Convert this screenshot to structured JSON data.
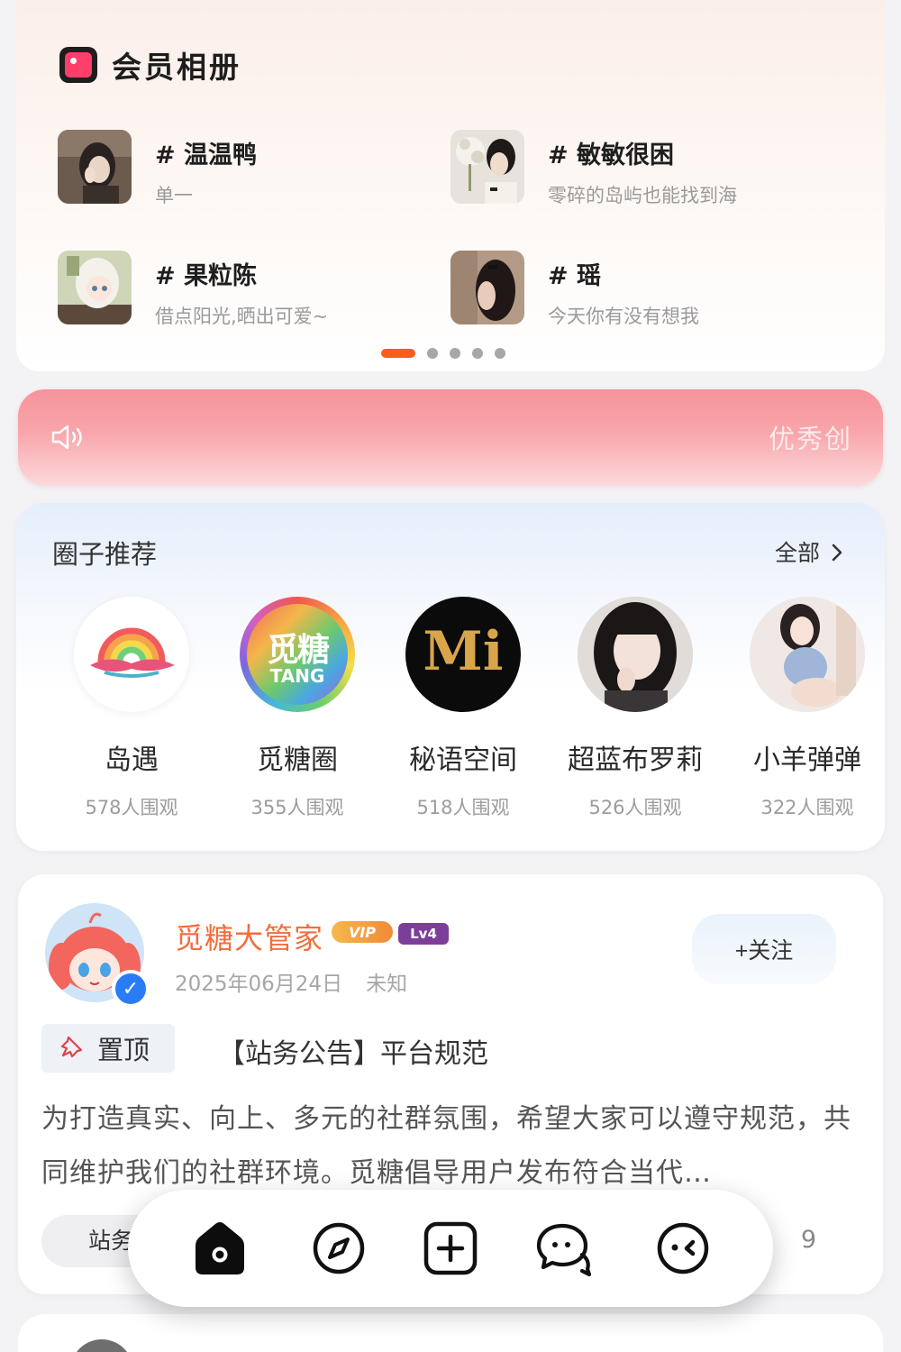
{
  "album": {
    "title": "会员相册",
    "items": [
      {
        "name": "# 温温鸭",
        "desc": "单一"
      },
      {
        "name": "# 敏敏很困",
        "desc": "零碎的岛屿也能找到海"
      },
      {
        "name": "# 果粒陈",
        "desc": "借点阳光,晒出可爱~"
      },
      {
        "name": "# 瑶",
        "desc": "今天你有没有想我"
      }
    ],
    "page_count": 5,
    "active_page": 1
  },
  "notice": {
    "text": "优秀创",
    "icon": "speaker-icon"
  },
  "circles": {
    "title": "圈子推荐",
    "all_label": "全部",
    "items": [
      {
        "name": "岛遇",
        "views": "578人围观"
      },
      {
        "name": "觅糖圈",
        "views": "355人围观",
        "logo_text": "觅糖",
        "logo_sub": "TANG"
      },
      {
        "name": "秘语空间",
        "views": "518人围观",
        "logo_text": "Mi"
      },
      {
        "name": "超蓝布罗莉",
        "views": "526人围观"
      },
      {
        "name": "小羊弹弹",
        "views": "322人围观"
      }
    ]
  },
  "post": {
    "author": "觅糖大管家",
    "vip_label": "VIP",
    "level_label": "Lv4",
    "date": "2025年06月24日",
    "location": "未知",
    "follow_label": "+关注",
    "pin_label": "置顶",
    "title": "【站务公告】平台规范",
    "body": "为打造真实、向上、多元的社群氛围，希望大家可以遵守规范，共同维护我们的社群环境。觅糖倡导用户发布符合当代…",
    "topic_label": "站务",
    "count": "9"
  },
  "nav": {
    "items": [
      "home-icon",
      "compass-icon",
      "add-icon",
      "message-icon",
      "profile-icon"
    ]
  },
  "colors": {
    "accent": "#ff5a1f",
    "author": "#f36d3c",
    "verify": "#2a7cf6"
  }
}
